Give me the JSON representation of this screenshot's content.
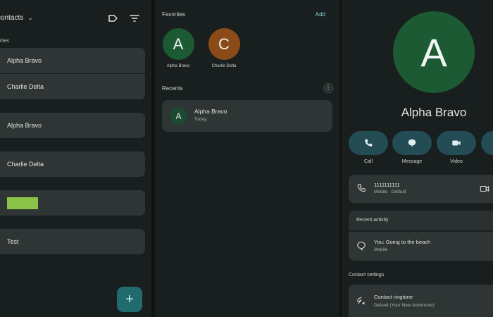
{
  "panel1": {
    "account_label": "contacts",
    "favorites_label": "orites",
    "favorite_rows": [
      "Alpha Bravo",
      "Charlie Delta"
    ],
    "contact_rows": [
      "Alpha Bravo",
      "Charlie Delta",
      "",
      "Test"
    ],
    "green_block_color": "#8bc34a",
    "fab_label": "+",
    "icons": [
      "label-icon",
      "filter-icon",
      "chevron-down-icon",
      "plus-icon"
    ]
  },
  "panel2": {
    "favorites_title": "Favorites",
    "add_label": "Add",
    "favorites": [
      {
        "initial": "A",
        "name": "Alpha Bravo",
        "color": "#1b5a32"
      },
      {
        "initial": "C",
        "name": "Charlie Delta",
        "color": "#8a4b18"
      }
    ],
    "recents_title": "Recents",
    "recent": {
      "initial": "A",
      "name": "Alpha Bravo",
      "time": "Today"
    },
    "more_icon": "more-vert-icon"
  },
  "panel3": {
    "avatar_initial": "A",
    "name": "Alpha Bravo",
    "actions": [
      {
        "label": "Call",
        "icon": "phone-icon"
      },
      {
        "label": "Message",
        "icon": "chat-bubble-icon"
      },
      {
        "label": "Video",
        "icon": "videocam-icon"
      },
      {
        "label": "",
        "icon": "more-action-icon"
      }
    ],
    "phone": {
      "number": "1111111111",
      "detail": "Mobile · Default"
    },
    "recent_activity": {
      "title": "Recent activity",
      "message": "You: Going to the beach",
      "detail": "Mobile"
    },
    "contact_settings": {
      "title": "Contact settings",
      "ringtone_title": "Contact ringtone",
      "ringtone_value": "Default (Your New Adventure)"
    },
    "accent_color": "#234c55"
  }
}
